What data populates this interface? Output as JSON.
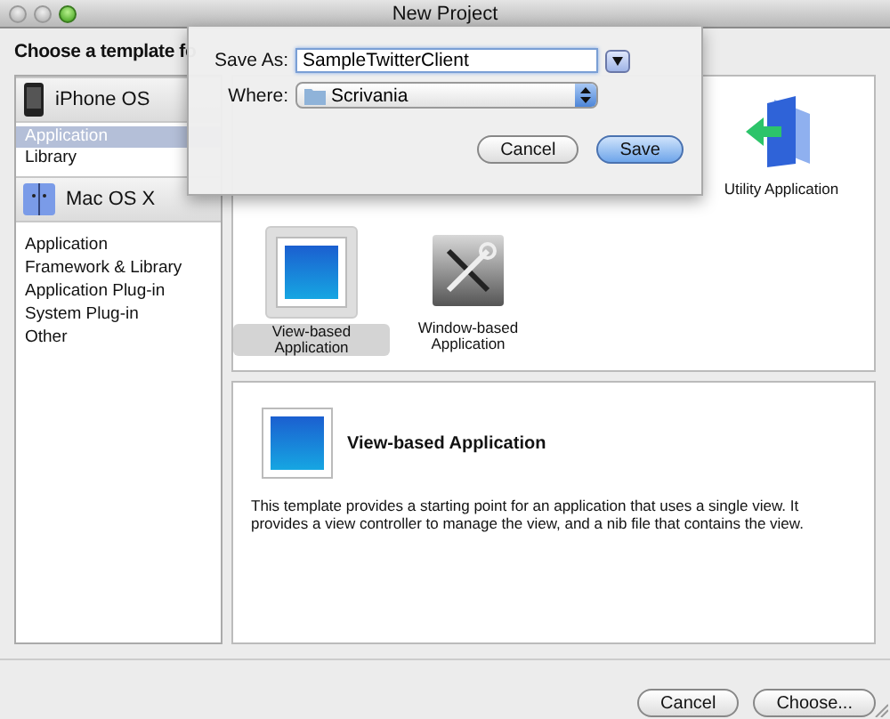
{
  "window": {
    "title": "New Project"
  },
  "heading": "Choose a template fo",
  "sidebar": {
    "groups": [
      {
        "label": "iPhone OS",
        "kind": "phone",
        "items": [
          {
            "label": "Application",
            "selected": true
          },
          {
            "label": "Library",
            "selected": false
          }
        ]
      },
      {
        "label": "Mac OS X",
        "kind": "mac",
        "items": [
          {
            "label": "Application",
            "selected": false
          },
          {
            "label": "Framework & Library",
            "selected": false
          },
          {
            "label": "Application Plug-in",
            "selected": false
          },
          {
            "label": "System Plug-in",
            "selected": false
          },
          {
            "label": "Other",
            "selected": false
          }
        ]
      }
    ]
  },
  "templates": [
    {
      "label": "Utility Application",
      "kind": "utility",
      "selected": false
    },
    {
      "label": "View-based Application",
      "kind": "view",
      "selected": true
    },
    {
      "label": "Window-based Application",
      "kind": "tools",
      "selected": false
    }
  ],
  "description": {
    "title": "View-based Application",
    "text": "This template provides a starting point for an application that uses a single view. It provides a view controller to manage the view, and a nib file that contains the view."
  },
  "sheet": {
    "save_as_label": "Save As:",
    "save_as_value": "SampleTwitterClient",
    "where_label": "Where:",
    "where_value": "Scrivania",
    "buttons": [
      {
        "label": "Cancel",
        "default": false
      },
      {
        "label": "Save",
        "default": true
      }
    ]
  },
  "buttons": [
    {
      "label": "Cancel"
    },
    {
      "label": "Choose..."
    }
  ]
}
